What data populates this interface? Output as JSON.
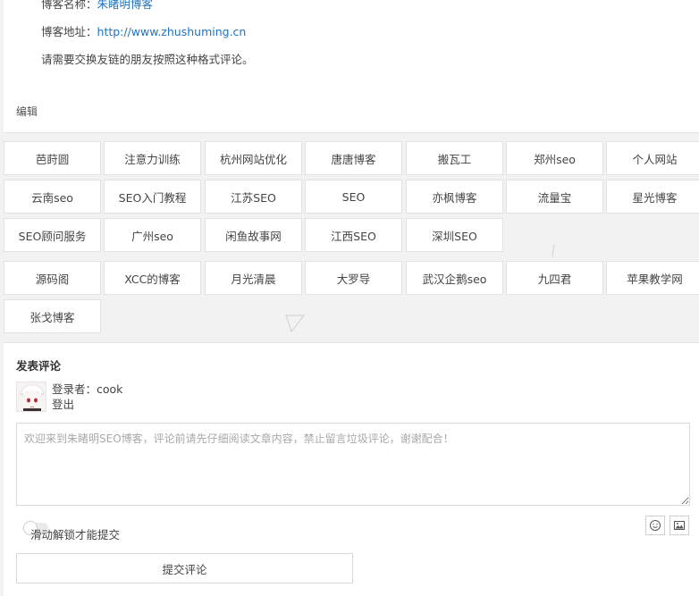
{
  "post": {
    "blog_name_label": "博客名称：",
    "blog_name_value": "朱睹明博客",
    "blog_url_label": "博客地址：",
    "blog_url_value": "http://www.zhushuming.cn",
    "request_text": "请需要交换友链的朋友按照这种格式评论。",
    "edit_label": "编辑"
  },
  "links": {
    "group1": [
      "芭莳圆",
      "注意力训练",
      "杭州网站优化",
      "唐唐博客",
      "搬瓦工",
      "郑州seo",
      "个人网站",
      "云南seo",
      "SEO入门教程",
      "江苏SEO",
      "SEO",
      "亦枫博客",
      "流量宝",
      "星光博客",
      "SEO顾问服务",
      "广州seo",
      "闲鱼故事网",
      "江西SEO",
      "深圳SEO"
    ],
    "group2": [
      "源码阁",
      "XCC的博客",
      "月光清晨",
      "大罗导",
      "武汉企鹅seo",
      "九四君",
      "苹果教学网",
      "张戈博客"
    ]
  },
  "comment": {
    "title": "发表评论",
    "login_prefix": "登录者：",
    "username": "cook",
    "logout_label": "登出",
    "textarea_placeholder": "欢迎来到朱睹明SEO博客，评论前请先仔细阅读文章内容，禁止留言垃圾评论，谢谢配合！",
    "slider_label": "滑动解锁才能提交",
    "submit_label": "提交评论",
    "emoji_icon": "smiley-icon",
    "image_icon": "image-icon"
  }
}
